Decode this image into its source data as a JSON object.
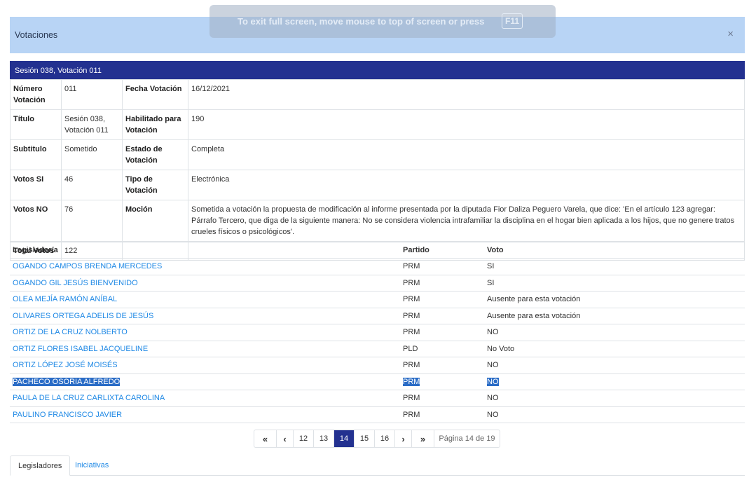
{
  "modal": {
    "title": "Votaciones",
    "close_icon": "×"
  },
  "fullscreen_notice": {
    "text": "To exit full screen, move mouse to top of screen or press",
    "key": "F11"
  },
  "session": {
    "title": "Sesión 038, Votación 011"
  },
  "details": {
    "numero_label": "Número Votación",
    "numero": "011",
    "fecha_label": "Fecha Votación",
    "fecha": "16/12/2021",
    "titulo_label": "Título",
    "titulo": "Sesión 038, Votación 011",
    "habilitado_label": "Habilitado para Votación",
    "habilitado": "190",
    "subtitulo_label": "Subtitulo",
    "subtitulo": "Sometido",
    "estado_label": "Estado de Votación",
    "estado": "Completa",
    "votos_si_label": "Votos SI",
    "votos_si": "46",
    "tipo_label": "Tipo de Votación",
    "tipo": "Electrónica",
    "votos_no_label": "Votos NO",
    "votos_no": "76",
    "mocion_label": "Moción",
    "mocion": "Sometida a votación la propuesta de modificación al informe presentada por la diputada Fior Daliza Peguero Varela, que dice: 'En el artículo 123 agregar: Párrafo Tercero, que diga de la siguiente manera: No se considera violencia intrafamiliar la disciplina en el hogar bien aplicada a los hijos, que no genere tratos crueles físicos o psicológicos'.",
    "total_label": "Total Votos",
    "total": "122"
  },
  "legislators": {
    "headers": {
      "name": "Legislador/a",
      "party": "Partido",
      "vote": "Voto"
    },
    "rows": [
      {
        "name": "OGANDO CAMPOS BRENDA MERCEDES",
        "party": "PRM",
        "vote": "SI"
      },
      {
        "name": "OGANDO GIL JESÚS BIENVENIDO",
        "party": "PRM",
        "vote": "SI"
      },
      {
        "name": "OLEA MEJÍA RAMÓN ANÍBAL",
        "party": "PRM",
        "vote": "Ausente para esta votación"
      },
      {
        "name": "OLIVARES ORTEGA ADELIS DE JESÚS",
        "party": "PRM",
        "vote": "Ausente para esta votación"
      },
      {
        "name": "ORTIZ DE LA CRUZ NOLBERTO",
        "party": "PRM",
        "vote": "NO"
      },
      {
        "name": "ORTIZ FLORES ISABEL JACQUELINE",
        "party": "PLD",
        "vote": "No Voto"
      },
      {
        "name": "ORTIZ LÓPEZ JOSÉ MOISÉS",
        "party": "PRM",
        "vote": "NO"
      },
      {
        "name": "PACHECO OSORIA ALFREDO",
        "party": "PRM",
        "vote": "NO"
      },
      {
        "name": "PAULA DE LA CRUZ CARLIXTA CAROLINA",
        "party": "PRM",
        "vote": "NO"
      },
      {
        "name": "PAULINO FRANCISCO JAVIER",
        "party": "PRM",
        "vote": "NO"
      }
    ]
  },
  "pagination": {
    "first_icon": "«",
    "prev_icon": "‹",
    "next_icon": "›",
    "last_icon": "»",
    "pages": [
      "12",
      "13",
      "14",
      "15",
      "16"
    ],
    "current": "14",
    "info": "Página 14 de 19"
  },
  "tabs": {
    "legisladores": "Legisladores",
    "iniciativas": "Iniciativas"
  }
}
